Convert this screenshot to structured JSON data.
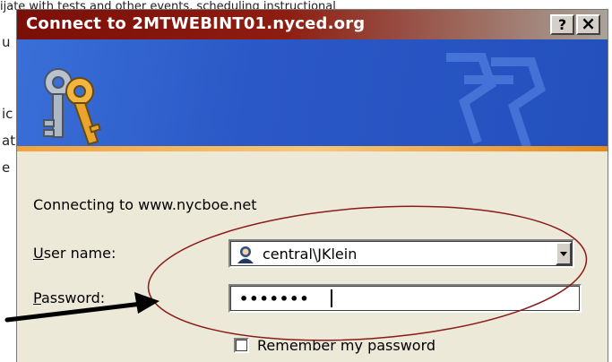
{
  "background_text": {
    "top_line": "ijate with tests and other events, scheduling instructional",
    "fragments": [
      "u",
      "ic",
      "at",
      "e"
    ]
  },
  "dialog": {
    "title": "Connect to 2MTWEBINT01.nyced.org",
    "help_button": "?",
    "close_button": "×",
    "connecting_text": "Connecting to www.nycboe.net",
    "username_label": "User name:",
    "username_mnemonic": "U",
    "username_rest": "ser name:",
    "username_value": "central\\JKlein",
    "password_label_mnemonic": "P",
    "password_label_rest": "assword:",
    "password_value": "•••••••",
    "remember_label": "Remember my password",
    "remember_checked": false
  },
  "colors": {
    "titlebar": "#7b0f08",
    "banner": "#2a58c6",
    "annotation_ellipse": "#8b1a1a",
    "annotation_arrow": "#000000"
  },
  "icons": [
    "keys-icon",
    "user-icon",
    "dropdown-arrow-icon",
    "watermark-keys-icon"
  ]
}
